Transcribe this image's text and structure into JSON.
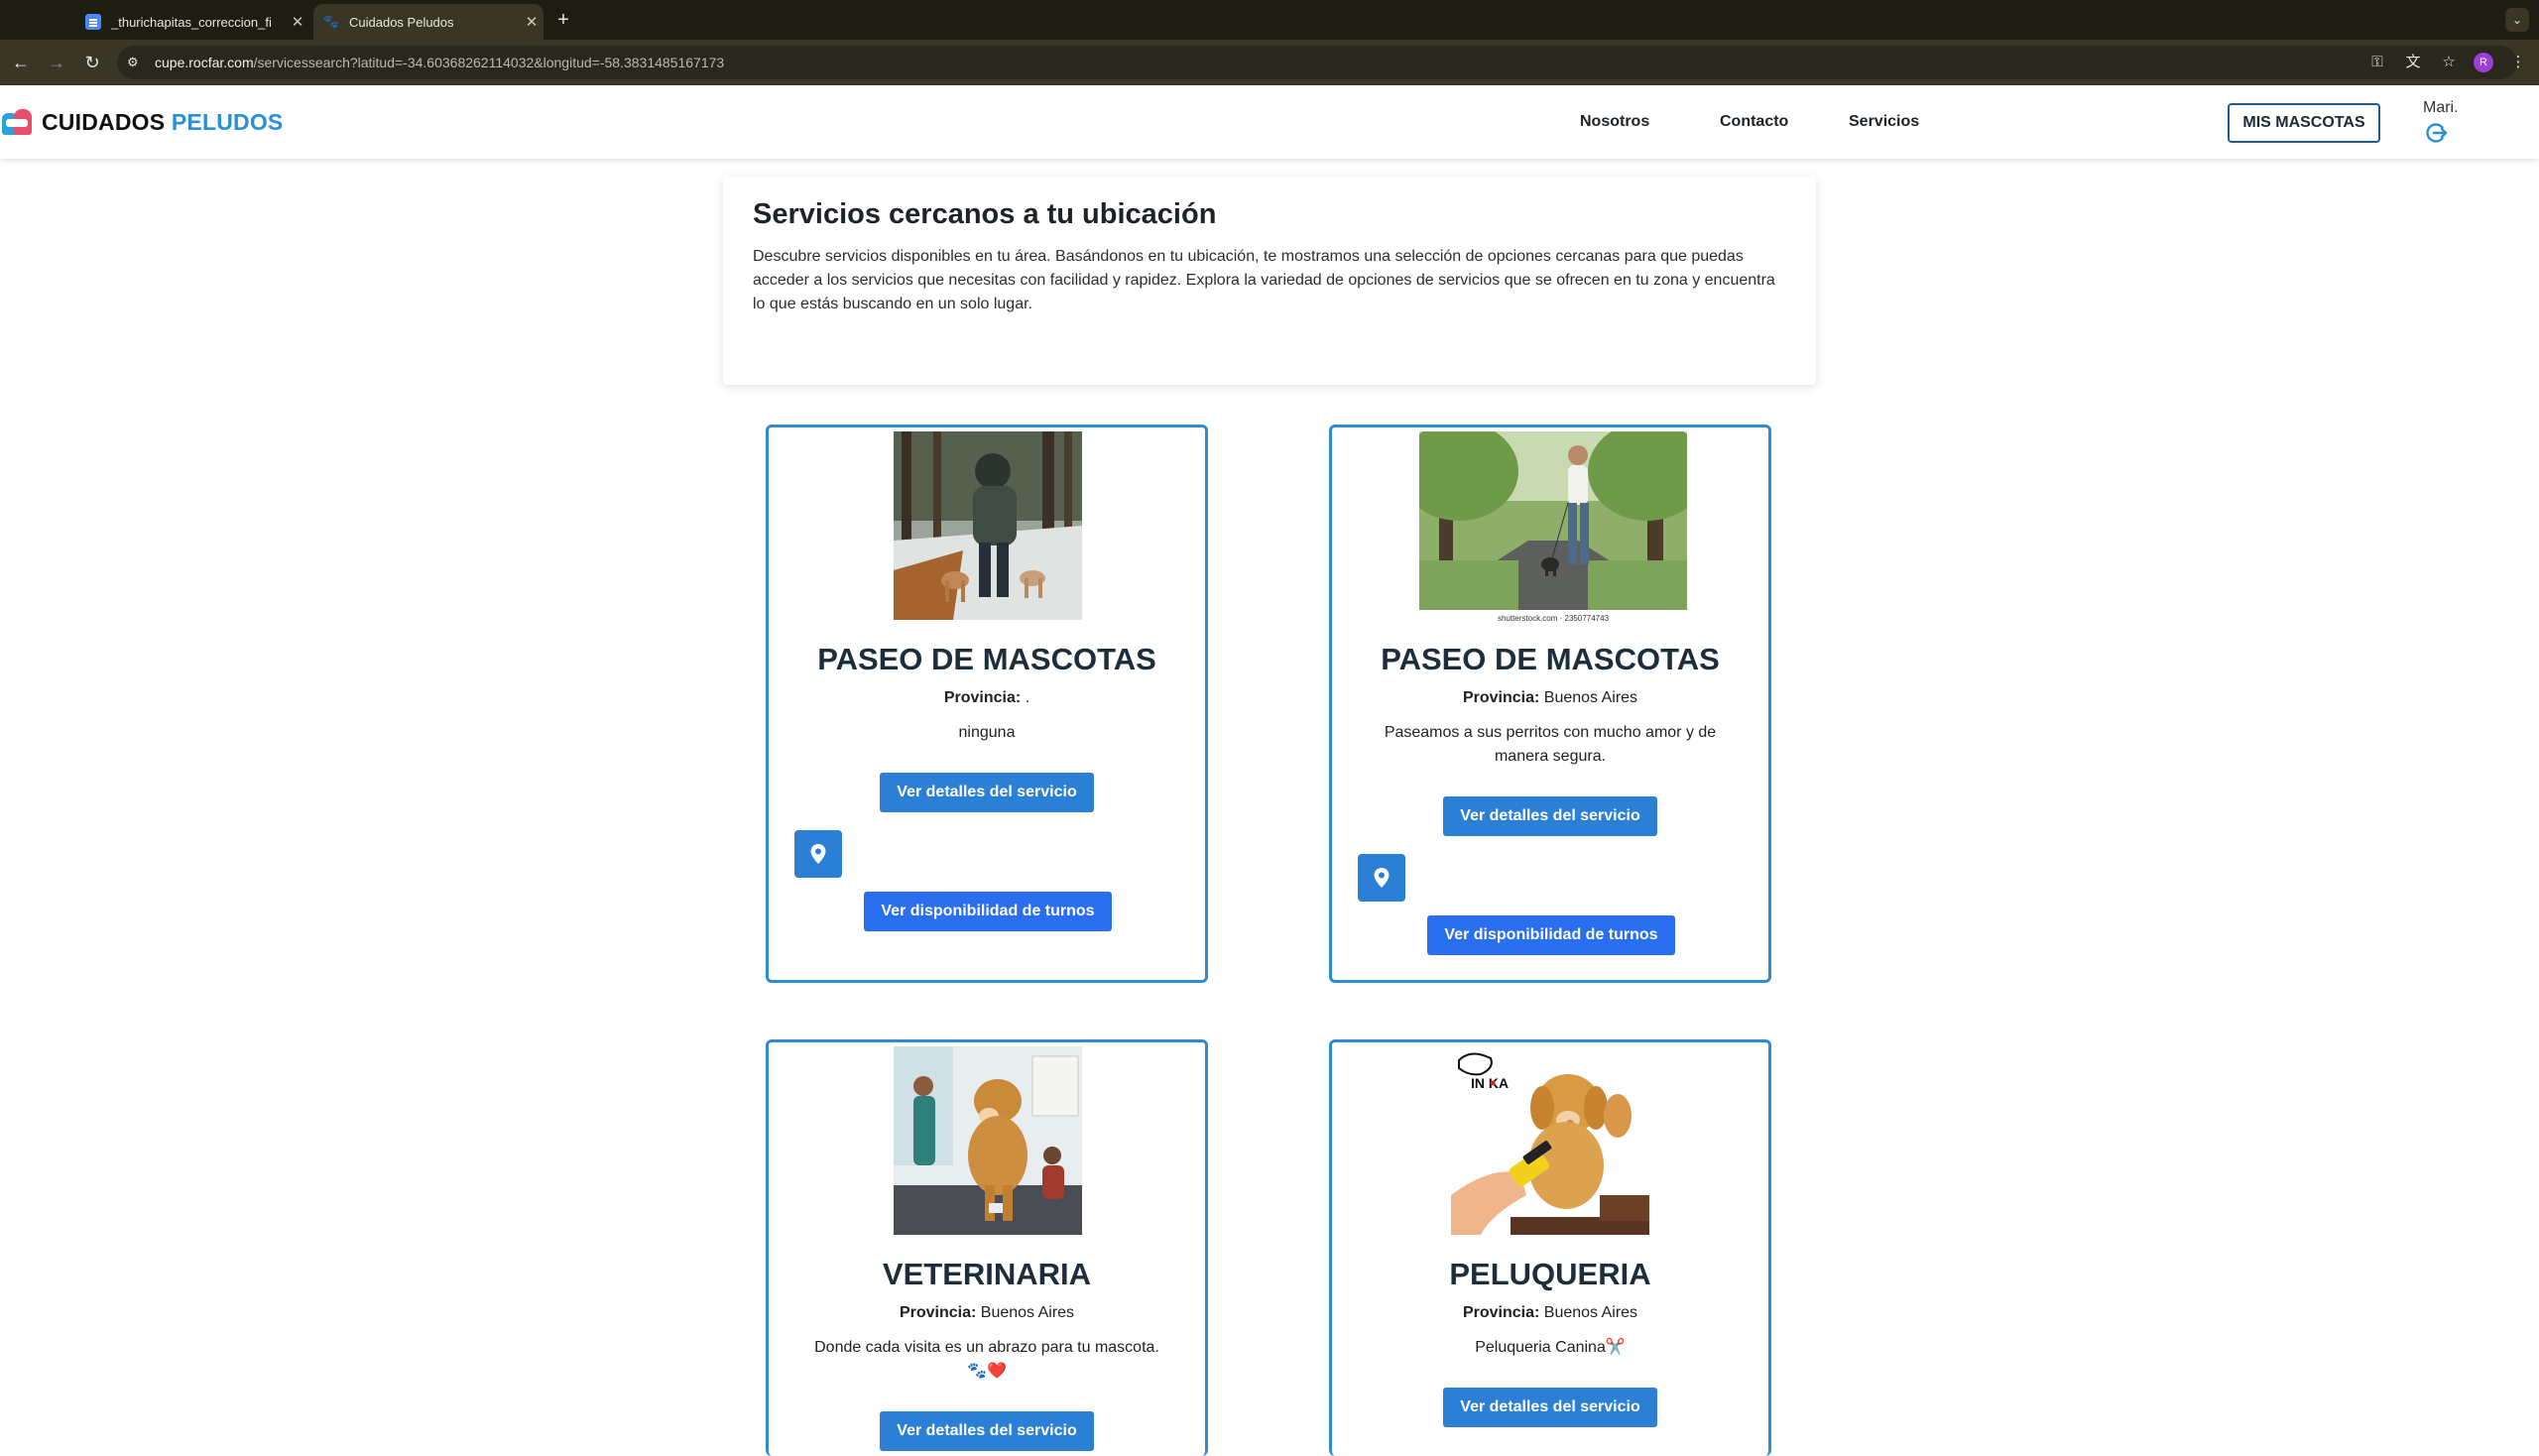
{
  "browser": {
    "tabs": [
      {
        "title": "_thurichapitas_correccion_fi",
        "active": false,
        "icon": "doc-icon"
      },
      {
        "title": "Cuidados Peludos",
        "active": true,
        "icon": "paw-icon"
      }
    ],
    "new_tab": "+",
    "url_host": "cupe.rocfar.com",
    "url_path": "/servicessearch?latitud=-34.60368262114032&longitud=-58.3831485167173",
    "profile_initial": "R"
  },
  "header": {
    "logo_first": "CUIDADOS",
    "logo_second": "PELUDOS",
    "nav": [
      "Nosotros",
      "Contacto",
      "Servicios"
    ],
    "mis_mascotas": "MIS MASCOTAS",
    "user_name": "Mari."
  },
  "intro": {
    "title": "Servicios cercanos a tu ubicación",
    "text": "Descubre servicios disponibles en tu área. Basándonos en tu ubicación, te mostramos una selección de opciones cercanas para que puedas acceder a los servicios que necesitas con facilidad y rapidez. Explora la variedad de opciones de servicios que se ofrecen en tu zona y encuentra lo que estás buscando en un solo lugar."
  },
  "cards": [
    {
      "title": "PASEO DE MASCOTAS",
      "province_label": "Provincia:",
      "province": ".",
      "description": "ninguna",
      "details_btn": "Ver detalles del servicio",
      "turnos_btn": "Ver disponibilidad de turnos"
    },
    {
      "title": "PASEO DE MASCOTAS",
      "province_label": "Provincia:",
      "province": "Buenos Aires",
      "description": "Paseamos a sus perritos con mucho amor y de manera segura.",
      "details_btn": "Ver detalles del servicio",
      "turnos_btn": "Ver disponibilidad de turnos",
      "image_caption": "shutterstock.com · 2350774743"
    },
    {
      "title": "VETERINARIA",
      "province_label": "Provincia:",
      "province": "Buenos Aires",
      "description": "Donde cada visita es un abrazo para tu mascota. 🐾❤️",
      "details_btn": "Ver detalles del servicio"
    },
    {
      "title": "PELUQUERIA",
      "province_label": "Provincia:",
      "province": "Buenos Aires",
      "description": "Peluqueria Canina✂️",
      "details_btn": "Ver detalles del servicio",
      "image_logo": "IN KA"
    }
  ]
}
